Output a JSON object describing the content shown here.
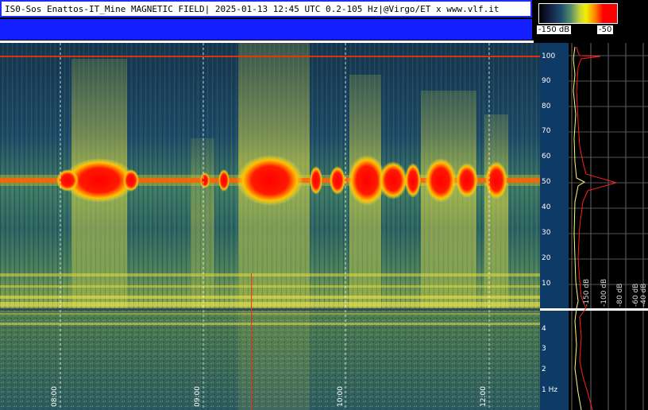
{
  "header": {
    "title": "IS0-Sos Enattos-IT_Mine MAGNETIC FIELD| 2025-01-13 12:45 UTC 0.2-105 Hz|@Virgo/ET x www.vlf.it"
  },
  "scale": {
    "min_label": "-150 dB",
    "max_label": "-50"
  },
  "freq_axis_upper": [
    "100",
    "90",
    "80",
    "70",
    "60",
    "50",
    "40",
    "30",
    "20",
    "10"
  ],
  "freq_axis_lower": [
    "4",
    "3",
    "2",
    "1 Hz"
  ],
  "time_labels": [
    "08:00",
    "09:00",
    "10:00",
    "12:00"
  ],
  "profile_db_labels": [
    "-150 dB",
    "-100 dB",
    "-80 dB",
    "-60 dB",
    "-40 dB"
  ],
  "colors": {
    "title_border": "#1a2cff",
    "blue_band": "#1420ff",
    "hot": "#ff0000",
    "mid": "#f2f000",
    "low": "#1f4a6e"
  }
}
